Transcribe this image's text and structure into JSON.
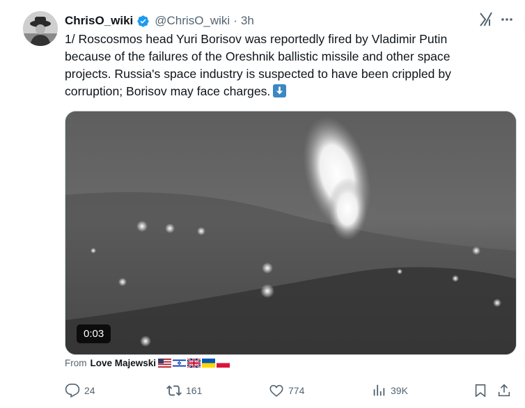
{
  "tweet": {
    "author_name": "ChrisO_wiki",
    "handle": "@ChrisO_wiki",
    "separator": "·",
    "time": "3h",
    "text": "1/ Roscosmos head Yuri Borisov was reportedly fired by Vladimir Putin\nbecause of the failures of the Oreshnik ballistic missile and other space\nprojects. Russia's space industry is suspected to have been crippled by\ncorruption; Borisov may face charges.",
    "emoji": "down-arrow-emoji"
  },
  "media": {
    "timestamp": "0:03"
  },
  "attribution": {
    "prefix": "From",
    "author": "Love Majewski",
    "flags": [
      "us-flag",
      "israel-flag",
      "uk-flag",
      "ukraine-flag",
      "poland-flag"
    ]
  },
  "actions": {
    "replies": "24",
    "reposts": "161",
    "likes": "774",
    "views": "39K"
  },
  "colors": {
    "text": "#0f1419",
    "secondary": "#536471",
    "verified": "#1d9bf0"
  }
}
